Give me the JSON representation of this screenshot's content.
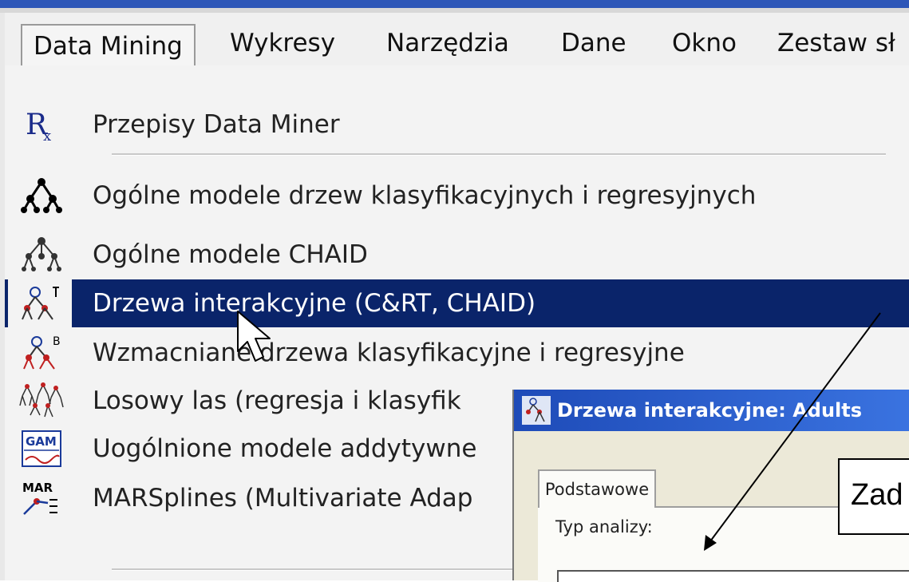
{
  "menubar": {
    "items": [
      "Data Mining",
      "Wykresy",
      "Narzędzia",
      "Dane",
      "Okno",
      "Zestaw sł"
    ]
  },
  "menu": {
    "items": [
      {
        "label": "Przepisy Data Miner",
        "icon": "rx-icon"
      },
      {
        "label": "Ogólne modele drzew klasyfikacyjnych i regresyjnych",
        "icon": "tree-icon"
      },
      {
        "label": "Ogólne modele CHAID",
        "icon": "chaid-tree-icon"
      },
      {
        "label": "Drzewa interakcyjne (C&RT, CHAID)",
        "icon": "interactive-tree-icon"
      },
      {
        "label": "Wzmacniane drzewa klasyfikacyjne i regresyjne",
        "icon": "boosted-tree-icon"
      },
      {
        "label": "Losowy las (regresja i klasyfik",
        "icon": "random-forest-icon"
      },
      {
        "label": "Uogólnione modele addytywne",
        "icon": "gam-icon"
      },
      {
        "label": "MARSplines (Multivariate Adap",
        "icon": "mars-icon"
      }
    ],
    "highlight_color": "#0a246a"
  },
  "dialog": {
    "title": "Drzewa interakcyjne: Adults",
    "tab": "Podstawowe",
    "field_label": "Typ analizy:"
  },
  "annotation": {
    "text": "Zad"
  },
  "icon_text": {
    "rx": "R",
    "gam": "GAM",
    "mar": "MAR"
  }
}
